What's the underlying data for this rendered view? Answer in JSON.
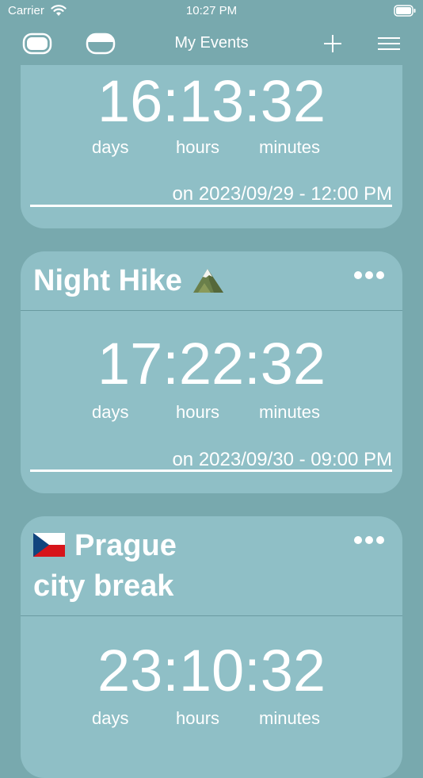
{
  "status_bar": {
    "carrier": "Carrier",
    "time": "10:27 PM"
  },
  "nav": {
    "title": "My Events"
  },
  "events": [
    {
      "title": "",
      "countdown": "16:13:32",
      "units": [
        "days",
        "hours",
        "minutes"
      ],
      "date": "on 2023/09/29 - 12:00 PM"
    },
    {
      "title": "Night Hike",
      "emoji": "mountain-icon",
      "countdown": "17:22:32",
      "units": [
        "days",
        "hours",
        "minutes"
      ],
      "date": "on 2023/09/30 - 09:00 PM"
    },
    {
      "title_line1": "Prague",
      "title_line2": "city break",
      "flag": "czech-flag-icon",
      "countdown": "23:10:32",
      "units": [
        "days",
        "hours",
        "minutes"
      ]
    }
  ],
  "colors": {
    "background": "#78a9ae",
    "card": "#8fbfc6",
    "text": "#ffffff"
  }
}
